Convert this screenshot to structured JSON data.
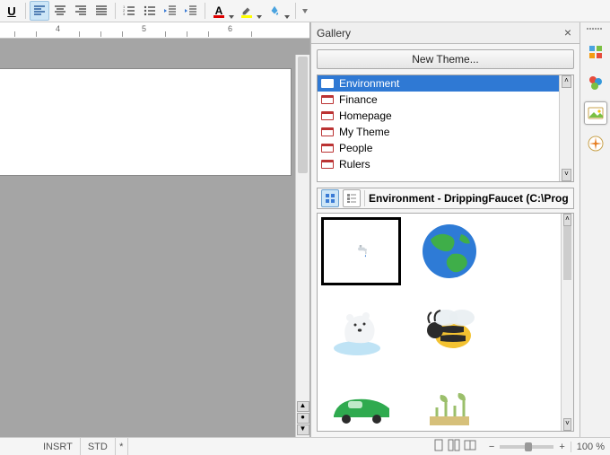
{
  "toolbar": {
    "underline_tip": "U",
    "fontcolor": "A"
  },
  "ruler": {
    "nums": [
      "4",
      "5",
      "6"
    ]
  },
  "gallery": {
    "title": "Gallery",
    "new_theme": "New Theme...",
    "themes": [
      "Environment",
      "Finance",
      "Homepage",
      "My Theme",
      "People",
      "Rulers"
    ],
    "selected_index": 0,
    "path_label": "Environment - DrippingFaucet (C:\\Prog",
    "items": [
      "DrippingFaucet",
      "Earth",
      "PolarBear",
      "Bee",
      "GreenCar",
      "Plant"
    ]
  },
  "sidebar": {
    "items": [
      "properties",
      "styles",
      "gallery",
      "navigator"
    ]
  },
  "status": {
    "insrt": "INSRT",
    "std": "STD",
    "zoom": "100 %"
  }
}
